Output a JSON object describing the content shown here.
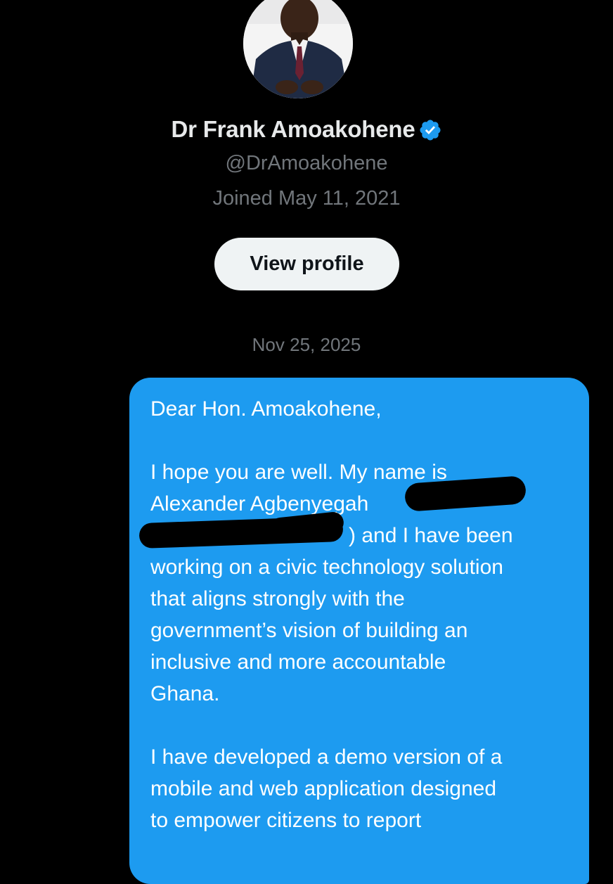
{
  "profile": {
    "name": "Dr Frank Amoakohene",
    "handle": "@DrAmoakohene",
    "joined": "Joined May 11, 2021",
    "verified_icon": "verified-badge-icon",
    "view_profile_label": "View profile"
  },
  "conversation": {
    "date": "Nov 25, 2025",
    "message": {
      "greeting": "Dear Hon. Amoakohene,",
      "p1_line1": "I hope you are well. My name is",
      "p1_line2": "Alexander Agbenyegah",
      "p1_line3": ") and I have been",
      "p1_line4": "working on a civic technology solution",
      "p1_line5": "that aligns strongly with the",
      "p1_line6": "government’s vision of building an",
      "p1_line7": "inclusive and more accountable",
      "p1_line8": "Ghana.",
      "p2_line1": "I have developed a demo version of a",
      "p2_line2": "mobile and web application designed",
      "p2_line3": "to empower citizens to report"
    }
  },
  "colors": {
    "background": "#000000",
    "bubble": "#1d9bf0",
    "verified": "#1d9bf0",
    "muted_text": "#71767b"
  }
}
